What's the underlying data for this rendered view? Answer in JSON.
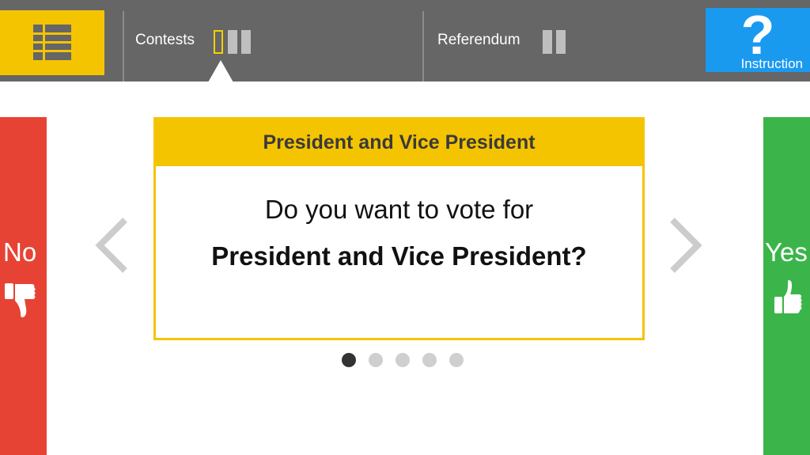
{
  "header": {
    "menu_icon": "list-icon",
    "tabs": [
      {
        "label": "Contests",
        "active": true
      },
      {
        "label": "Referendum",
        "active": false
      }
    ],
    "help": {
      "symbol": "?",
      "label": "Instruction"
    }
  },
  "vote": {
    "no_label": "No",
    "no_icon": "thumbs-down-icon",
    "yes_label": "Yes",
    "yes_icon": "thumbs-up-icon"
  },
  "card": {
    "title": "President and Vice President",
    "question_line1": "Do you want to vote for",
    "question_line2": "President and Vice President?"
  },
  "pagination": {
    "total": 5,
    "current": 1
  },
  "colors": {
    "topbar": "#666666",
    "accent_yellow": "#f5c400",
    "help_blue": "#1a9aef",
    "no_red": "#e74334",
    "yes_green": "#3bb54a"
  }
}
